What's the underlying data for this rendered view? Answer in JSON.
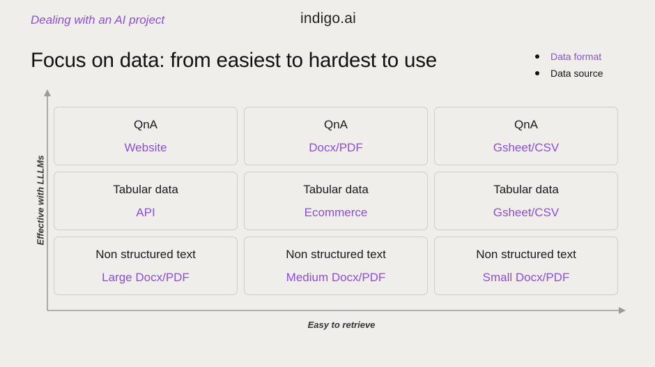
{
  "header": {
    "project_label": "Dealing with an AI project",
    "logo": "indigo.ai"
  },
  "title": "Focus on data: from easiest to hardest to use",
  "legend": {
    "items": [
      {
        "label": "Data format",
        "color": "#8b4fd6"
      },
      {
        "label": "Data source",
        "color": "#111111"
      }
    ]
  },
  "axes": {
    "y_label": "Effective with LLLMs",
    "x_label": "Easy to retrieve"
  },
  "grid": {
    "rows": [
      [
        {
          "format": "QnA",
          "source": "Website"
        },
        {
          "format": "QnA",
          "source": "Docx/PDF"
        },
        {
          "format": "QnA",
          "source": "Gsheet/CSV"
        }
      ],
      [
        {
          "format": "Tabular data",
          "source": "API"
        },
        {
          "format": "Tabular data",
          "source": "Ecommerce"
        },
        {
          "format": "Tabular data",
          "source": "Gsheet/CSV"
        }
      ],
      [
        {
          "format": "Non structured text",
          "source": "Large Docx/PDF"
        },
        {
          "format": "Non structured text",
          "source": "Medium Docx/PDF"
        },
        {
          "format": "Non structured text",
          "source": "Small Docx/PDF"
        }
      ]
    ]
  },
  "colors": {
    "accent": "#8b4fd6",
    "background": "#efeeeb",
    "axis": "#9a9a9a"
  }
}
